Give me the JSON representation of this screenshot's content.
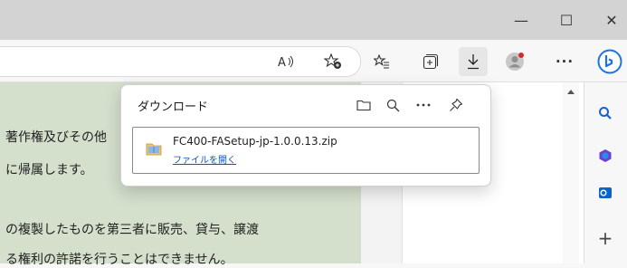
{
  "window": {
    "minimize_glyph": "—",
    "maximize_glyph": "☐",
    "close_glyph": "✕"
  },
  "toolbar": {
    "read_aloud_icon": "read-aloud-icon",
    "add_favorite_icon": "add-favorite-icon",
    "favorites_icon": "favorites-icon",
    "collections_icon": "collections-icon",
    "downloads_icon": "downloads-icon",
    "profile_icon": "profile-icon",
    "more_label": "···",
    "copilot_icon": "bing-copilot-icon"
  },
  "page": {
    "lines": [
      "著作権及びその他",
      "に帰属します。",
      "の複製したものを第三者に販売、貸与、譲渡",
      "る権利の許諾を行うことはできません。"
    ]
  },
  "downloads": {
    "title": "ダウンロード",
    "items": [
      {
        "file_name": "FC400-FASetup-jp-1.0.0.13.zip",
        "action": "ファイルを開く"
      }
    ]
  },
  "sidebar": {
    "add_label": "+"
  },
  "colors": {
    "accent": "#0b57c2",
    "page_bg": "#d4dfcc",
    "titlebar": "#d3d3d3"
  }
}
